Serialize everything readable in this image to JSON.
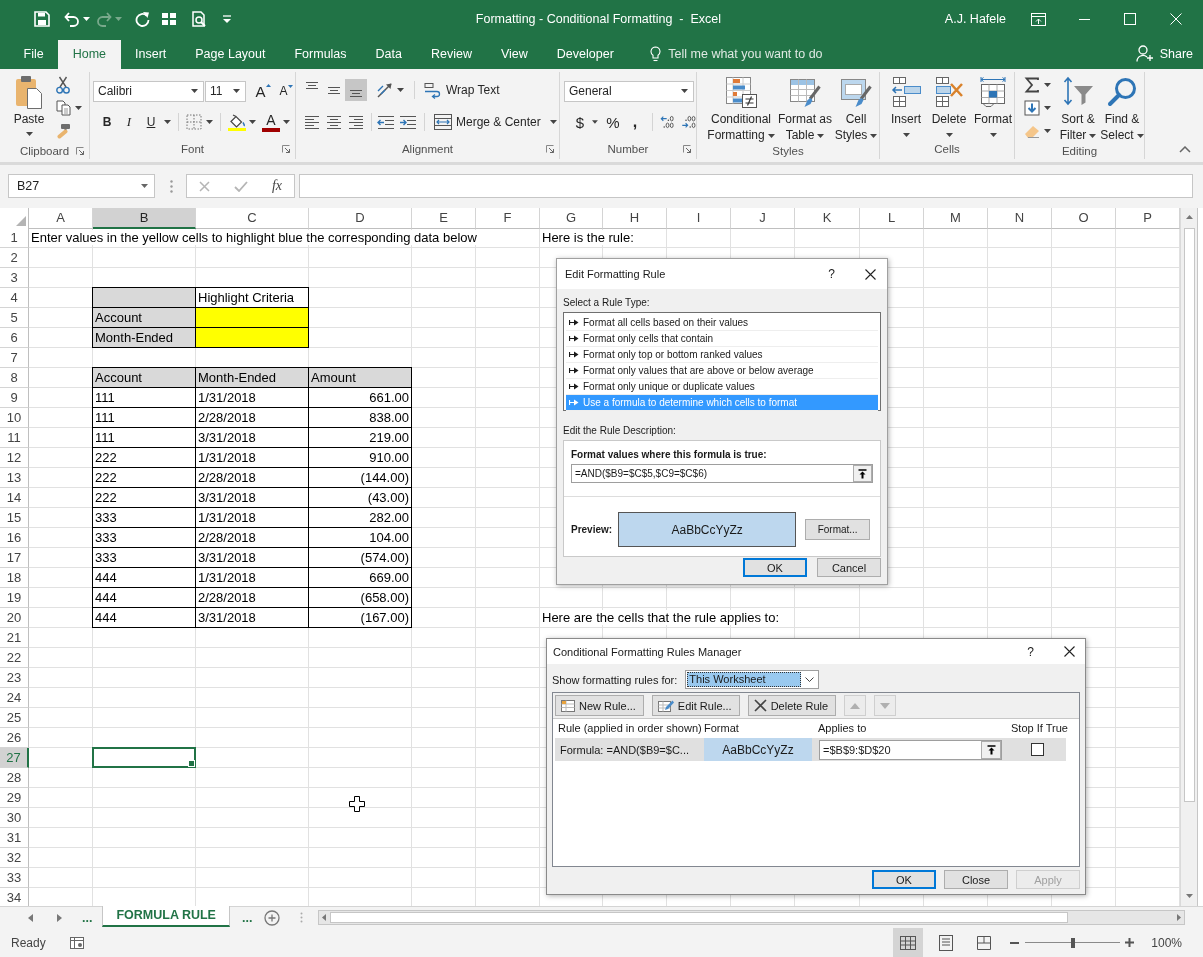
{
  "window": {
    "title": "Formatting - Conditional Formatting  -  Excel",
    "user": "A.J. Hafele"
  },
  "quick_access": [
    {
      "kind": "save",
      "disabled": false
    },
    {
      "kind": "undo",
      "disabled": false
    },
    {
      "kind": "redo",
      "disabled": true
    },
    {
      "kind": "repeat",
      "disabled": false
    },
    {
      "kind": "touch",
      "disabled": false
    },
    {
      "kind": "preview",
      "disabled": false
    },
    {
      "kind": "customize",
      "disabled": false
    }
  ],
  "tabs": [
    {
      "label": "File",
      "selected": false
    },
    {
      "label": "Home",
      "selected": true
    },
    {
      "label": "Insert",
      "selected": false
    },
    {
      "label": "Page Layout",
      "selected": false
    },
    {
      "label": "Formulas",
      "selected": false
    },
    {
      "label": "Data",
      "selected": false
    },
    {
      "label": "Review",
      "selected": false
    },
    {
      "label": "View",
      "selected": false
    },
    {
      "label": "Developer",
      "selected": false
    }
  ],
  "tell_me": {
    "placeholder": "Tell me what you want to do"
  },
  "share": "Share",
  "ribbon": {
    "clipboard": {
      "label": "Clipboard",
      "paste": "Paste"
    },
    "font": {
      "label": "Font",
      "name": "Calibri",
      "size": "11",
      "grow": "A",
      "shrink": "A",
      "bold": "B",
      "italic": "I",
      "underline": "U",
      "font_color": "A"
    },
    "alignment": {
      "label": "Alignment",
      "vertical": [
        {
          "kind": "top",
          "selected": false
        },
        {
          "kind": "middle",
          "selected": false
        },
        {
          "kind": "bottom",
          "selected": true
        }
      ],
      "horizontal": [
        {
          "kind": "left",
          "selected": false
        },
        {
          "kind": "center",
          "selected": false
        },
        {
          "kind": "right",
          "selected": false
        }
      ],
      "wrap_text": "Wrap Text",
      "merge": "Merge & Center"
    },
    "number": {
      "label": "Number",
      "format": "General",
      "currency": "$",
      "percent": "%",
      "comma": ","
    },
    "styles": {
      "label": "Styles",
      "buttons": [
        {
          "kind": "conditional",
          "label": "Conditional Formatting"
        },
        {
          "kind": "table",
          "label": "Format as Table"
        },
        {
          "kind": "cell",
          "label": "Cell Styles"
        }
      ]
    },
    "cells": {
      "label": "Cells",
      "buttons": [
        {
          "kind": "insert",
          "label": "Insert"
        },
        {
          "kind": "delete",
          "label": "Delete"
        },
        {
          "kind": "format",
          "label": "Format"
        }
      ]
    },
    "editing": {
      "label": "Editing",
      "buttons": [
        {
          "kind": "sort",
          "label": "Sort & Filter"
        },
        {
          "kind": "find",
          "label": "Find & Select"
        }
      ]
    }
  },
  "formula_bar": {
    "name_box": "B27",
    "insert_function": "fx"
  },
  "sheet": {
    "columns": [
      {
        "label": "A",
        "selected": false
      },
      {
        "label": "B",
        "selected": true
      },
      {
        "label": "C",
        "selected": false
      },
      {
        "label": "D",
        "selected": false
      },
      {
        "label": "E",
        "selected": false
      },
      {
        "label": "F",
        "selected": false
      },
      {
        "label": "G",
        "selected": false
      },
      {
        "label": "H",
        "selected": false
      },
      {
        "label": "I",
        "selected": false
      },
      {
        "label": "J",
        "selected": false
      },
      {
        "label": "K",
        "selected": false
      },
      {
        "label": "L",
        "selected": false
      },
      {
        "label": "M",
        "selected": false
      },
      {
        "label": "N",
        "selected": false
      },
      {
        "label": "O",
        "selected": false
      },
      {
        "label": "P",
        "selected": false
      }
    ],
    "rows": [
      {
        "label": "1",
        "selected": false,
        "cells": {
          "A": {
            "text": "Enter values in the yellow cells to highlight blue the corresponding data below",
            "kind": "text",
            "bordered": false
          },
          "G": {
            "text": "Here is the rule:",
            "kind": "text",
            "bordered": false
          }
        }
      },
      {
        "label": "2",
        "selected": false
      },
      {
        "label": "3",
        "selected": false
      },
      {
        "label": "4",
        "selected": false,
        "cells": {
          "B": {
            "kind": "text",
            "bordered": true,
            "color": "#d9d9d9"
          },
          "C": {
            "text": "Highlight Criteria",
            "kind": "text",
            "bordered": true
          }
        }
      },
      {
        "label": "5",
        "selected": false,
        "cells": {
          "B": {
            "text": "Account",
            "kind": "text",
            "bordered": true,
            "color": "#d9d9d9"
          },
          "C": {
            "kind": "text",
            "bordered": true,
            "color": "#ffff00"
          }
        }
      },
      {
        "label": "6",
        "selected": false,
        "cells": {
          "B": {
            "text": "Month-Ended",
            "kind": "text",
            "bordered": true,
            "color": "#d9d9d9"
          },
          "C": {
            "kind": "text",
            "bordered": true,
            "color": "#ffff00"
          }
        }
      },
      {
        "label": "7",
        "selected": false
      },
      {
        "label": "8",
        "selected": false,
        "cells": {
          "B": {
            "text": "Account",
            "kind": "text",
            "bordered": true,
            "color": "#d9d9d9"
          },
          "C": {
            "text": "Month-Ended",
            "kind": "text",
            "bordered": true,
            "color": "#d9d9d9"
          },
          "D": {
            "text": "Amount",
            "kind": "text",
            "bordered": true,
            "color": "#d9d9d9"
          }
        }
      },
      {
        "label": "9",
        "selected": false,
        "cells": {
          "B": {
            "text": "111",
            "kind": "text",
            "bordered": true
          },
          "C": {
            "text": "1/31/2018",
            "kind": "text",
            "bordered": true
          },
          "D": {
            "text": "661.00",
            "kind": "number",
            "bordered": true
          }
        }
      },
      {
        "label": "10",
        "selected": false,
        "cells": {
          "B": {
            "text": "111",
            "kind": "text",
            "bordered": true
          },
          "C": {
            "text": "2/28/2018",
            "kind": "text",
            "bordered": true
          },
          "D": {
            "text": "838.00",
            "kind": "number",
            "bordered": true
          }
        }
      },
      {
        "label": "11",
        "selected": false,
        "cells": {
          "B": {
            "text": "111",
            "kind": "text",
            "bordered": true
          },
          "C": {
            "text": "3/31/2018",
            "kind": "text",
            "bordered": true
          },
          "D": {
            "text": "219.00",
            "kind": "number",
            "bordered": true
          }
        }
      },
      {
        "label": "12",
        "selected": false,
        "cells": {
          "B": {
            "text": "222",
            "kind": "text",
            "bordered": true
          },
          "C": {
            "text": "1/31/2018",
            "kind": "text",
            "bordered": true
          },
          "D": {
            "text": "910.00",
            "kind": "number",
            "bordered": true
          }
        }
      },
      {
        "label": "13",
        "selected": false,
        "cells": {
          "B": {
            "text": "222",
            "kind": "text",
            "bordered": true
          },
          "C": {
            "text": "2/28/2018",
            "kind": "text",
            "bordered": true
          },
          "D": {
            "text": "(144.00)",
            "kind": "number",
            "bordered": true
          }
        }
      },
      {
        "label": "14",
        "selected": false,
        "cells": {
          "B": {
            "text": "222",
            "kind": "text",
            "bordered": true
          },
          "C": {
            "text": "3/31/2018",
            "kind": "text",
            "bordered": true
          },
          "D": {
            "text": "(43.00)",
            "kind": "number",
            "bordered": true
          }
        }
      },
      {
        "label": "15",
        "selected": false,
        "cells": {
          "B": {
            "text": "333",
            "kind": "text",
            "bordered": true
          },
          "C": {
            "text": "1/31/2018",
            "kind": "text",
            "bordered": true
          },
          "D": {
            "text": "282.00",
            "kind": "number",
            "bordered": true
          }
        }
      },
      {
        "label": "16",
        "selected": false,
        "cells": {
          "B": {
            "text": "333",
            "kind": "text",
            "bordered": true
          },
          "C": {
            "text": "2/28/2018",
            "kind": "text",
            "bordered": true
          },
          "D": {
            "text": "104.00",
            "kind": "number",
            "bordered": true
          }
        }
      },
      {
        "label": "17",
        "selected": false,
        "cells": {
          "B": {
            "text": "333",
            "kind": "text",
            "bordered": true
          },
          "C": {
            "text": "3/31/2018",
            "kind": "text",
            "bordered": true
          },
          "D": {
            "text": "(574.00)",
            "kind": "number",
            "bordered": true
          }
        }
      },
      {
        "label": "18",
        "selected": false,
        "cells": {
          "B": {
            "text": "444",
            "kind": "text",
            "bordered": true
          },
          "C": {
            "text": "1/31/2018",
            "kind": "text",
            "bordered": true
          },
          "D": {
            "text": "669.00",
            "kind": "number",
            "bordered": true
          }
        }
      },
      {
        "label": "19",
        "selected": false,
        "cells": {
          "B": {
            "text": "444",
            "kind": "text",
            "bordered": true
          },
          "C": {
            "text": "2/28/2018",
            "kind": "text",
            "bordered": true
          },
          "D": {
            "text": "(658.00)",
            "kind": "number",
            "bordered": true
          }
        }
      },
      {
        "label": "20",
        "selected": false,
        "cells": {
          "B": {
            "text": "444",
            "kind": "text",
            "bordered": true
          },
          "C": {
            "text": "3/31/2018",
            "kind": "text",
            "bordered": true
          },
          "D": {
            "text": "(167.00)",
            "kind": "number",
            "bordered": true
          },
          "G": {
            "text": "Here are the cells that the rule applies to:",
            "kind": "text",
            "bordered": false
          }
        }
      },
      {
        "label": "21",
        "selected": false
      },
      {
        "label": "22",
        "selected": false
      },
      {
        "label": "23",
        "selected": false
      },
      {
        "label": "24",
        "selected": false
      },
      {
        "label": "25",
        "selected": false
      },
      {
        "label": "26",
        "selected": false
      },
      {
        "label": "27",
        "selected": true
      },
      {
        "label": "28",
        "selected": false
      },
      {
        "label": "29",
        "selected": false
      },
      {
        "label": "30",
        "selected": false
      },
      {
        "label": "31",
        "selected": false
      },
      {
        "label": "32",
        "selected": false
      },
      {
        "label": "33",
        "selected": false
      },
      {
        "label": "34",
        "selected": false
      }
    ]
  },
  "rule_dialog": {
    "title": "Edit Formatting Rule",
    "help": "?",
    "type_label": "Select a Rule Type:",
    "rule_types": [
      {
        "label": "Format all cells based on their values",
        "selected": false
      },
      {
        "label": "Format only cells that contain",
        "selected": false
      },
      {
        "label": "Format only top or bottom ranked values",
        "selected": false
      },
      {
        "label": "Format only values that are above or below average",
        "selected": false
      },
      {
        "label": "Format only unique or duplicate values",
        "selected": false
      },
      {
        "label": "Use a formula to determine which cells to format",
        "selected": true
      }
    ],
    "description_label": "Edit the Rule Description:",
    "formula_label": "Format values where this formula is true:",
    "formula": "=AND($B9=$C$5,$C9=$C$6)",
    "preview_label": "Preview:",
    "preview": "AaBbCcYyZz",
    "format_button": "Format...",
    "buttons": [
      {
        "label": "OK",
        "default": true
      },
      {
        "label": "Cancel",
        "default": false
      }
    ]
  },
  "rules_manager": {
    "title": "Conditional Formatting Rules Manager",
    "help": "?",
    "show_label": "Show formatting rules for:",
    "show_value": "This Worksheet",
    "toolbar": [
      {
        "kind": "new",
        "label": "New Rule...",
        "disabled": false
      },
      {
        "kind": "edit",
        "label": "Edit Rule...",
        "disabled": false
      },
      {
        "kind": "delete",
        "label": "Delete Rule",
        "disabled": false
      },
      {
        "kind": "up",
        "disabled": true
      },
      {
        "kind": "down",
        "disabled": true
      }
    ],
    "columns": [
      "Rule (applied in order shown)",
      "Format",
      "Applies to",
      "Stop If True"
    ],
    "rules": [
      {
        "rule": "Formula: =AND($B9=$C...",
        "format": "AaBbCcYyZz",
        "applies_to": "=$B$9:$D$20",
        "stop_if_true": false,
        "selected": true
      }
    ],
    "buttons": [
      {
        "label": "OK",
        "default": true,
        "disabled": false
      },
      {
        "label": "Close",
        "default": false,
        "disabled": false
      },
      {
        "label": "Apply",
        "default": false,
        "disabled": true
      }
    ]
  },
  "sheet_tabs": {
    "before": "...",
    "tabs": [
      {
        "label": "FORMULA RULE",
        "selected": true
      }
    ],
    "after": "..."
  },
  "status_bar": {
    "status": "Ready",
    "views": [
      {
        "kind": "normal",
        "selected": true
      },
      {
        "kind": "page_layout",
        "selected": false
      },
      {
        "kind": "page_break",
        "selected": false
      }
    ],
    "zoom": {
      "level": 0.5,
      "reading": "100%"
    }
  }
}
